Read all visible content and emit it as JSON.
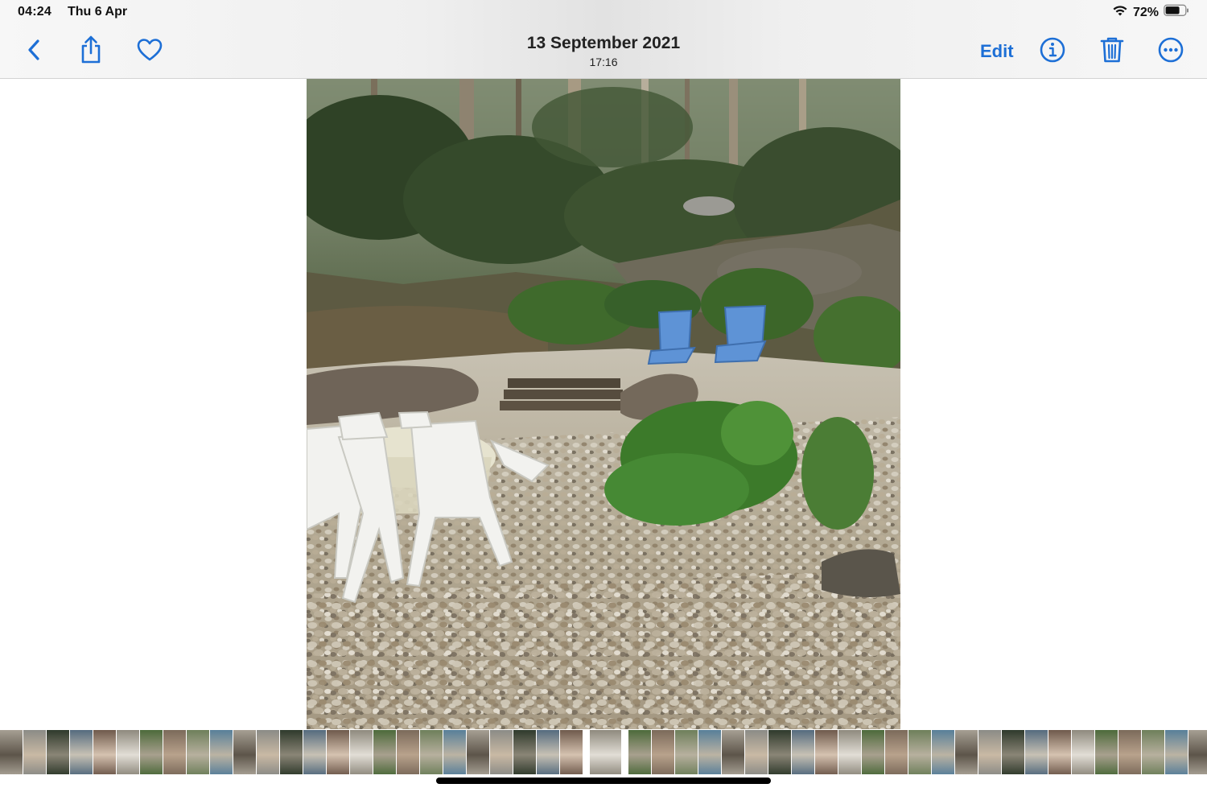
{
  "status": {
    "time": "04:24",
    "date": "Thu 6 Apr",
    "battery_percent": "72%",
    "battery_level": 0.72,
    "wifi_icon": "wifi-icon"
  },
  "toolbar": {
    "title": "13 September 2021",
    "subtitle": "17:16",
    "edit_label": "Edit",
    "accent_color": "#1d6fd6",
    "icons": [
      "back-chevron-icon",
      "share-icon",
      "heart-icon",
      "info-icon",
      "trash-icon",
      "more-icon"
    ]
  },
  "photo": {
    "subject": "gravel garden with white plastic table and chairs, two blue loungers, forest slope"
  },
  "filmstrip": {
    "thumbnail_count": 52,
    "selected_index": 25
  }
}
